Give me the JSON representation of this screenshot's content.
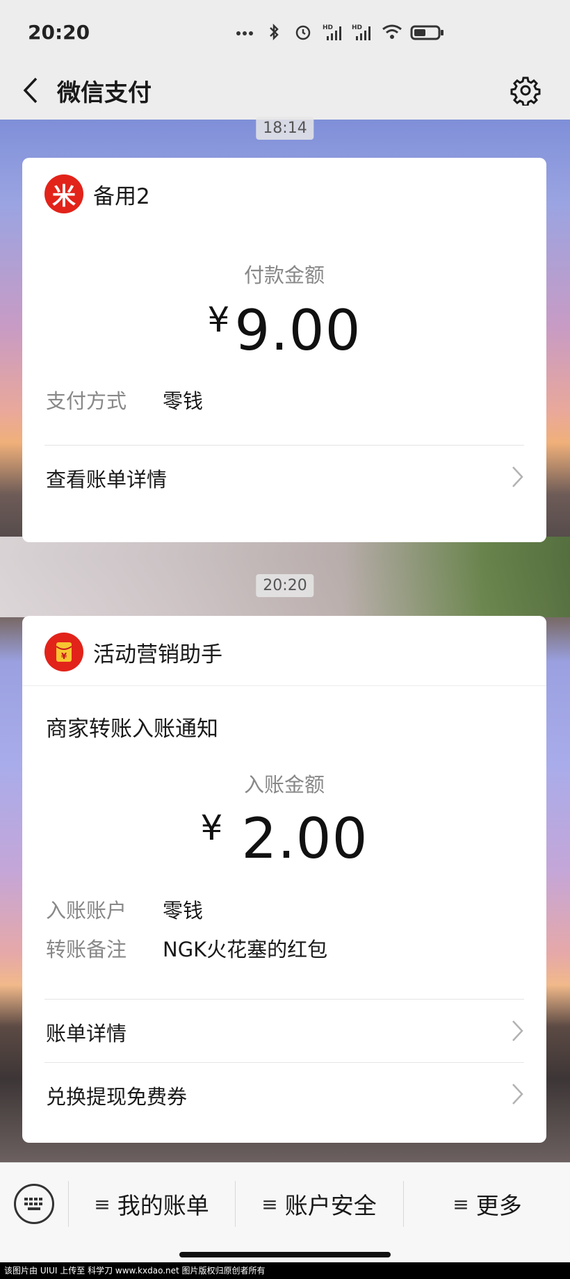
{
  "status_bar": {
    "time": "20:20",
    "icons": [
      "more-dots-icon",
      "bluetooth-icon",
      "alarm-icon",
      "signal-hd-icon",
      "signal-hd-icon",
      "wifi-icon",
      "battery-icon"
    ]
  },
  "nav": {
    "title": "微信支付",
    "back_icon": "chevron-left-icon",
    "settings_icon": "gear-icon"
  },
  "messages": [
    {
      "timestamp": "18:14",
      "merchant": "备用2",
      "logo_text": "米",
      "amount_label": "付款金额",
      "currency": "¥",
      "amount": "9.00",
      "details": [
        {
          "key": "支付方式",
          "value": "零钱"
        }
      ],
      "links": [
        "查看账单详情"
      ]
    },
    {
      "timestamp": "20:20",
      "merchant": "活动营销助手",
      "logo_text": "¥",
      "title": "商家转账入账通知",
      "amount_label": "入账金额",
      "currency": "¥",
      "amount": "2.00",
      "details": [
        {
          "key": "入账账户",
          "value": "零钱"
        },
        {
          "key": "转账备注",
          "value": "NGK火花塞的红包"
        }
      ],
      "links": [
        "账单详情",
        "兑换提现免费券"
      ]
    }
  ],
  "bottom_menu": {
    "keyboard_icon": "keyboard-icon",
    "items": [
      {
        "icon": "≡",
        "label": "我的账单"
      },
      {
        "icon": "≡",
        "label": "账户安全"
      },
      {
        "icon": "≡",
        "label": "更多"
      }
    ]
  },
  "footer_note": "该图片由 UIUI 上传至 科学刀 www.kxdao.net 图片版权归原创者所有",
  "colors": {
    "brand_red": "#e2231a",
    "background": "#ededed",
    "card": "#ffffff"
  }
}
